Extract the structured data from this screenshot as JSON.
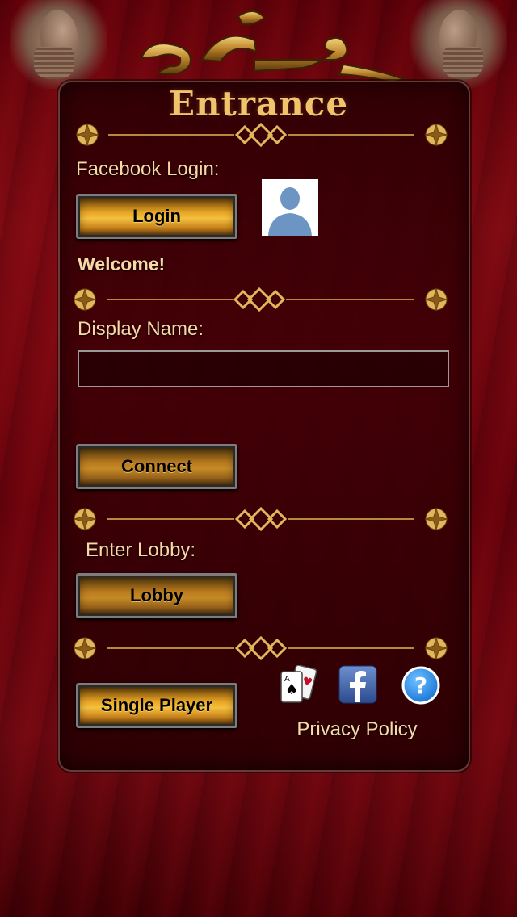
{
  "header": {
    "title": "Entrance",
    "logo_icon": "calligraphy-logo-icon",
    "statue_icon": "persian-statue-icon"
  },
  "facebook": {
    "label": "Facebook Login:",
    "login_button": "Login",
    "avatar_icon": "default-avatar-icon",
    "welcome": "Welcome!"
  },
  "display_name": {
    "label": "Display Name:",
    "value": "",
    "placeholder": "",
    "connect_button": "Connect"
  },
  "lobby": {
    "label": "Enter Lobby:",
    "button": "Lobby"
  },
  "footer": {
    "single_player_button": "Single Player",
    "cards_icon": "playing-cards-icon",
    "facebook_icon": "facebook-icon",
    "help_icon": "help-icon",
    "privacy_policy": "Privacy Policy"
  },
  "colors": {
    "gold_text": "#f1c36a",
    "label_text": "#f6d9a6",
    "background": "#5a0008"
  }
}
